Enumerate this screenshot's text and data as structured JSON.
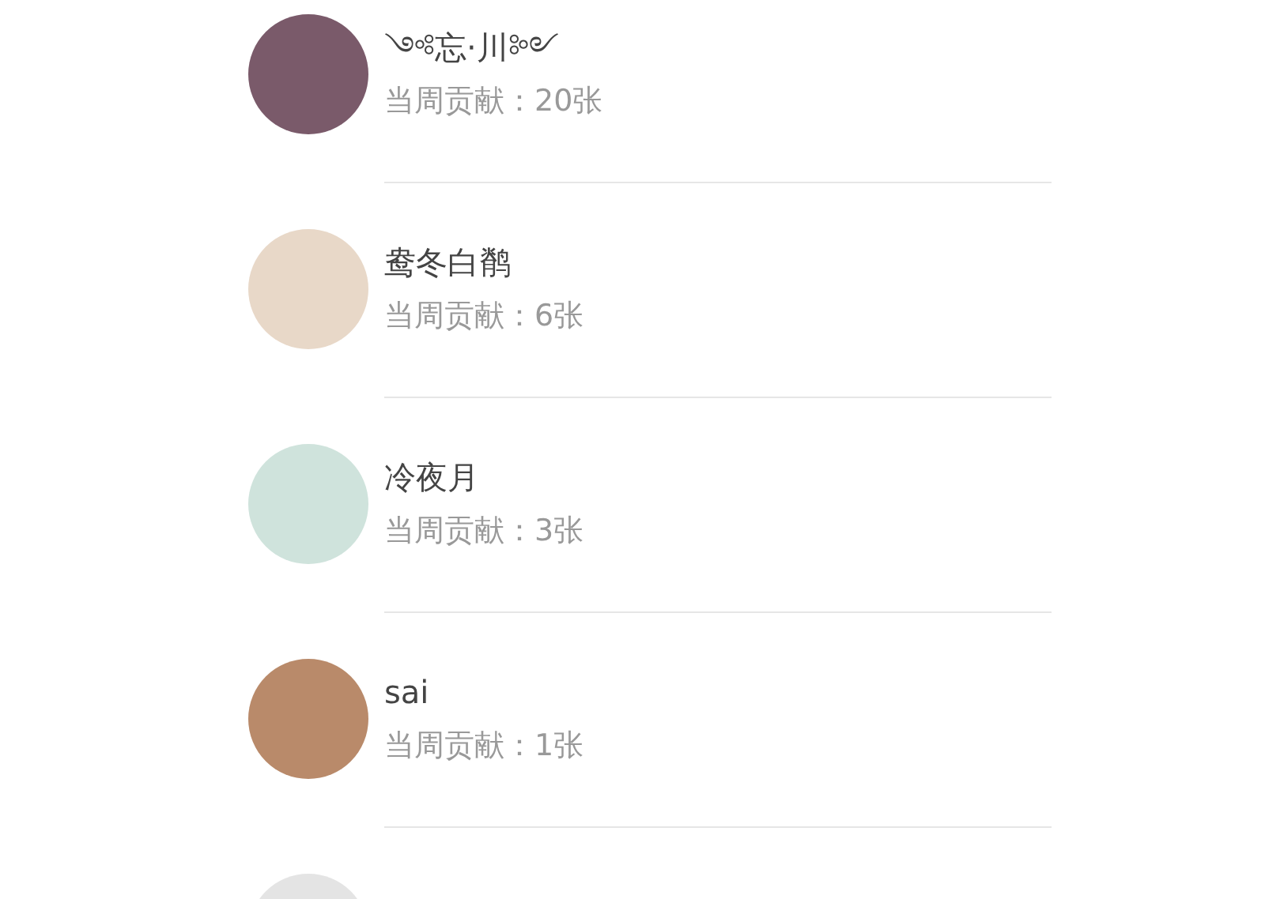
{
  "contributors": [
    {
      "name": "༺忘·川༻",
      "contribution": "当周贡献：20张",
      "color": "#7a5a6a"
    },
    {
      "name": "鸯冬白鹡",
      "contribution": "当周贡献：6张",
      "color": "#e8d8c8"
    },
    {
      "name": "冷夜月",
      "contribution": "当周贡献：3张",
      "color": "#cfe3dc"
    },
    {
      "name": "sai",
      "contribution": "当周贡献：1张",
      "color": "#b98a6a"
    },
    {
      "color": "#e4e4e4"
    }
  ]
}
